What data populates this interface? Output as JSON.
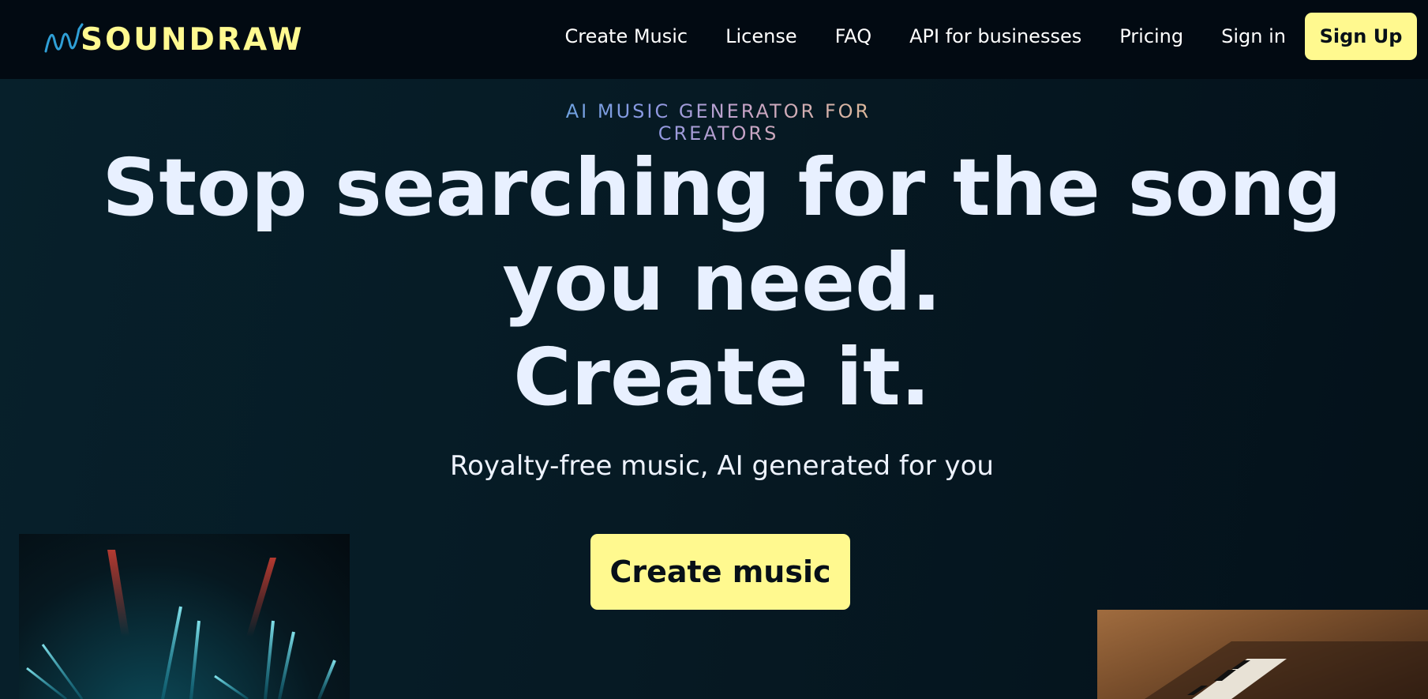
{
  "header": {
    "logo_text": "SOUNDRAW",
    "nav": [
      {
        "label": "Create Music"
      },
      {
        "label": "License"
      },
      {
        "label": "FAQ"
      },
      {
        "label": "API for businesses"
      },
      {
        "label": "Pricing"
      },
      {
        "label": "Sign in"
      }
    ],
    "signup_label": "Sign Up"
  },
  "hero": {
    "eyebrow": "AI MUSIC GENERATOR FOR CREATORS",
    "headline_line1": "Stop searching for the song you need.",
    "headline_line2": "Create it.",
    "subline": "Royalty-free music, AI generated for you",
    "cta_label": "Create music"
  },
  "colors": {
    "brand_yellow": "#fff98f",
    "header_bg": "#020a12",
    "hero_bg": "#061a24",
    "headline": "#e8f0ff"
  },
  "icons": {
    "logo_wave": "soundwave-icon"
  }
}
